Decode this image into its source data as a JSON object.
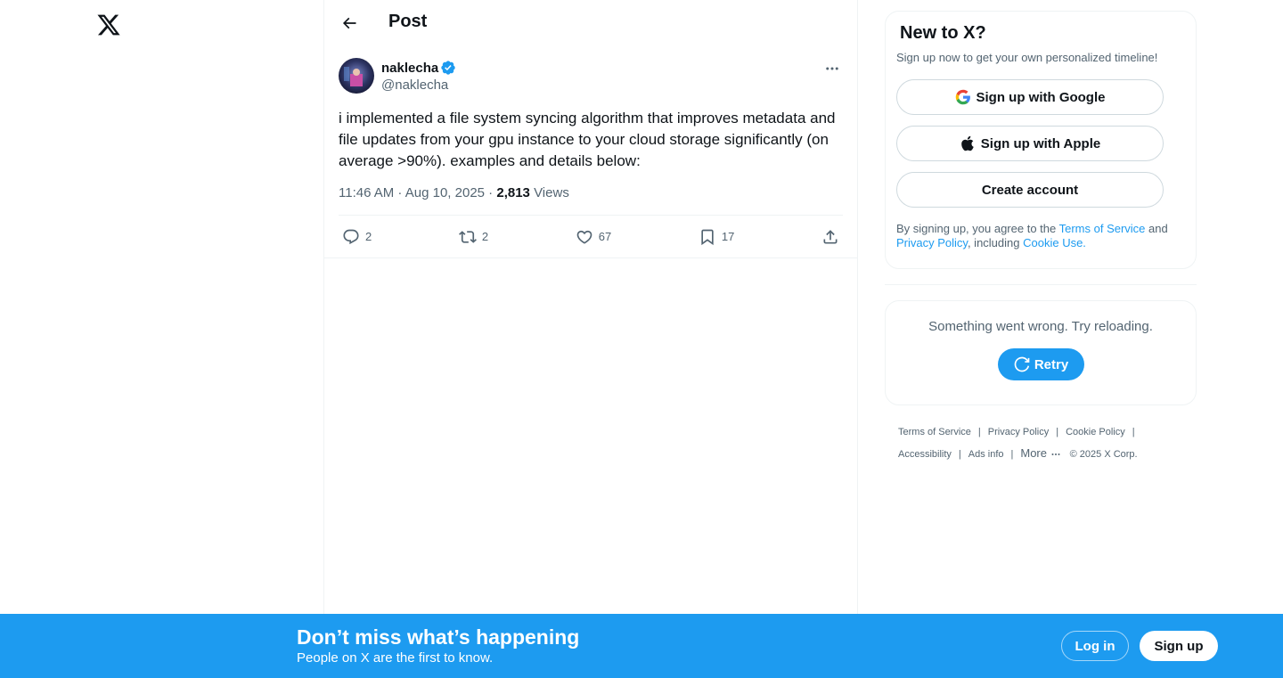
{
  "header": {
    "title": "Post"
  },
  "post": {
    "author_name": "naklecha",
    "author_handle": "@naklecha",
    "text": "i implemented a file system syncing algorithm that improves metadata and file updates from your gpu instance to your cloud storage significantly (on average >90%). examples and details below:",
    "timestamp": "11:46 AM · Aug 10, 2025",
    "separator": " · ",
    "views_count": "2,813",
    "views_label": " Views",
    "replies": "2",
    "reposts": "2",
    "likes": "67",
    "bookmarks": "17"
  },
  "signup_card": {
    "title": "New to X?",
    "subtitle": "Sign up now to get your own personalized timeline!",
    "google_label": "Sign up with Google",
    "apple_label": "Sign up with Apple",
    "create_label": "Create account",
    "legal_prefix": "By signing up, you agree to the ",
    "terms_link": "Terms of Service",
    "legal_and": " and ",
    "privacy_link": "Privacy Policy",
    "legal_including": ", including ",
    "cookie_link": "Cookie Use."
  },
  "error_card": {
    "message": "Something went wrong. Try reloading.",
    "retry_label": "Retry"
  },
  "footer": {
    "terms": "Terms of Service",
    "privacy": "Privacy Policy",
    "cookie": "Cookie Policy",
    "accessibility": "Accessibility",
    "ads": "Ads info",
    "more": "More",
    "copyright": "© 2025 X Corp.",
    "pipe": "|"
  },
  "bottom_bar": {
    "title": "Don’t miss what’s happening",
    "subtitle": "People on X are the first to know.",
    "login_label": "Log in",
    "signup_label": "Sign up"
  },
  "colors": {
    "accent": "#1d9bf0",
    "text_primary": "#0f1419",
    "text_secondary": "#536471",
    "border": "#eff3f4"
  },
  "icons": [
    "x-logo-icon",
    "back-arrow-icon",
    "verified-badge-icon",
    "more-dots-icon",
    "reply-icon",
    "repost-icon",
    "like-icon",
    "bookmark-icon",
    "share-icon",
    "google-icon",
    "apple-icon",
    "refresh-icon"
  ]
}
